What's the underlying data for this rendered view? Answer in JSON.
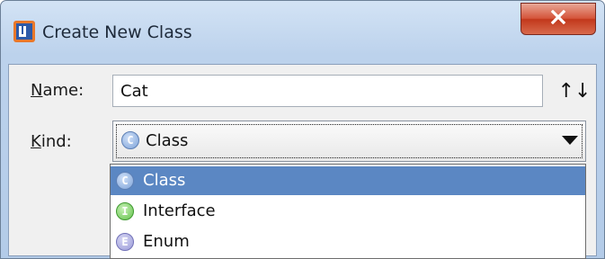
{
  "window": {
    "title": "Create New Class"
  },
  "form": {
    "name_label": "Name:",
    "name_value": "Cat",
    "kind_label": "Kind:",
    "kind_selected": "Class",
    "sort_glyph": "↑↓"
  },
  "kind_options": [
    {
      "label": "Class",
      "icon": "class-icon",
      "letter": "C",
      "selected": true
    },
    {
      "label": "Interface",
      "icon": "interface-icon",
      "letter": "I",
      "selected": false
    },
    {
      "label": "Enum",
      "icon": "enum-icon",
      "letter": "E",
      "selected": false
    }
  ],
  "colors": {
    "selection": "#5b87c3",
    "close_button": "#c2381c",
    "title_bar": "#bcd2ec"
  }
}
